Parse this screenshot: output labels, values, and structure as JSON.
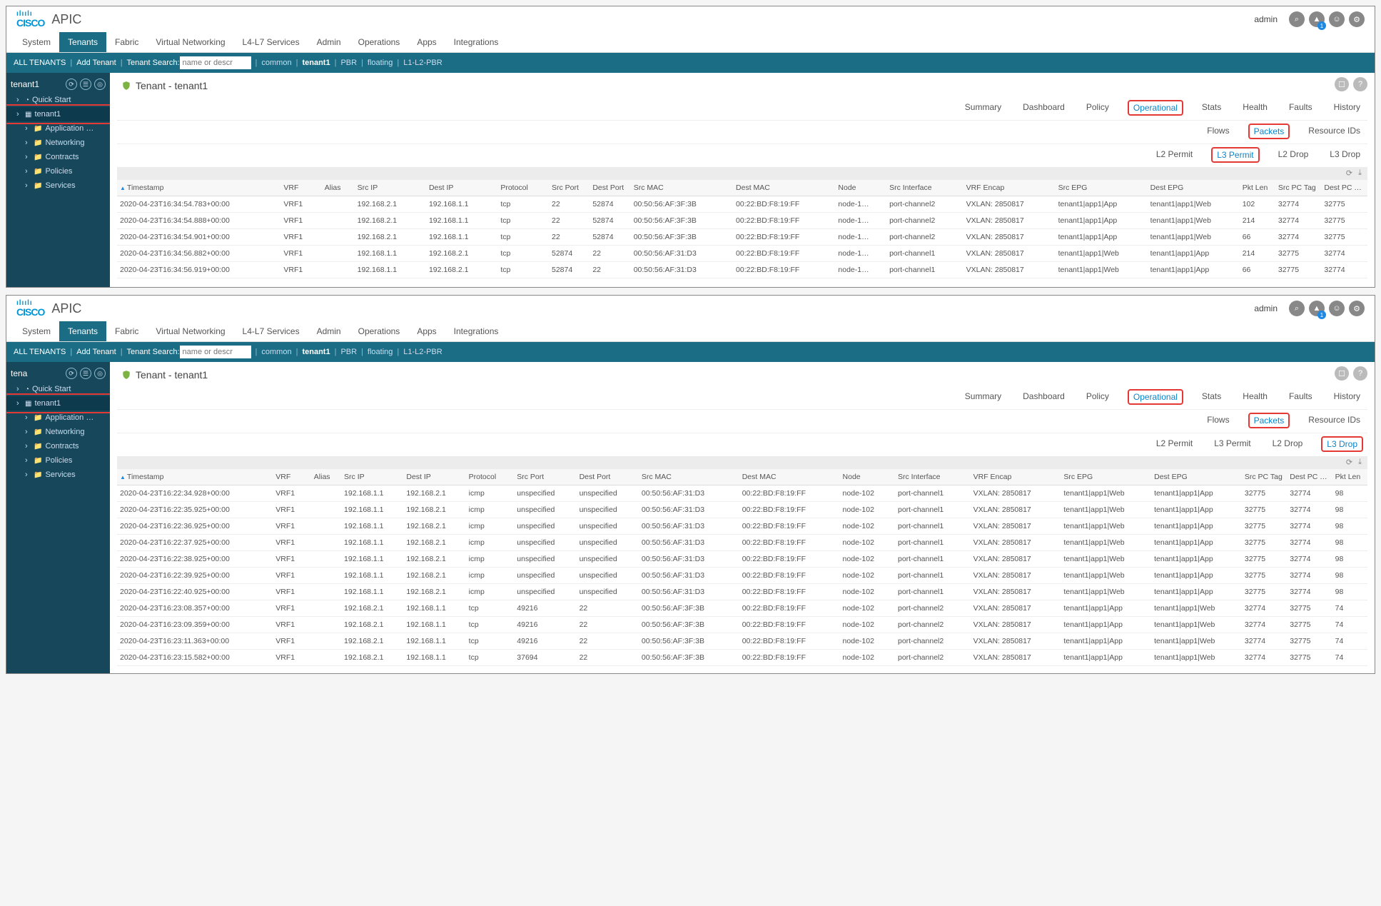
{
  "common": {
    "apic_title": "APIC",
    "user": "admin",
    "badge": "1",
    "menu": [
      "System",
      "Tenants",
      "Fabric",
      "Virtual Networking",
      "L4-L7 Services",
      "Admin",
      "Operations",
      "Apps",
      "Integrations"
    ],
    "menu_active": "Tenants",
    "subbar": {
      "all_tenants": "ALL TENANTS",
      "add_tenant": "Add Tenant",
      "tenant_search": "Tenant Search:",
      "placeholder": "name or descr",
      "links": [
        "common",
        "tenant1",
        "PBR",
        "floating",
        "L1-L2-PBR"
      ],
      "active_link": "tenant1"
    },
    "page_title_prefix": "Tenant - ",
    "tenant": "tenant1",
    "tabs1": [
      "Summary",
      "Dashboard",
      "Policy",
      "Operational",
      "Stats",
      "Health",
      "Faults",
      "History"
    ],
    "tabs1_active": "Operational",
    "tabs2": [
      "Flows",
      "Packets",
      "Resource IDs"
    ],
    "tabs2_active": "Packets",
    "tabs3": [
      "L2 Permit",
      "L3 Permit",
      "L2 Drop",
      "L3 Drop"
    ]
  },
  "top": {
    "sidebar_head": "tenant1",
    "tree": [
      {
        "label": "Quick Start",
        "icon": "◔",
        "sub": false
      },
      {
        "label": "tenant1",
        "icon": "▦",
        "sub": false,
        "selected": true,
        "highlight": true
      },
      {
        "label": "Application …",
        "icon": "📁",
        "sub": true,
        "obscured": true
      },
      {
        "label": "Networking",
        "icon": "📁",
        "sub": true
      },
      {
        "label": "Contracts",
        "icon": "📁",
        "sub": true
      },
      {
        "label": "Policies",
        "icon": "📁",
        "sub": true
      },
      {
        "label": "Services",
        "icon": "📁",
        "sub": true
      }
    ],
    "tabs3_active": "L3 Permit",
    "columns": [
      "Timestamp",
      "VRF",
      "Alias",
      "Src IP",
      "Dest IP",
      "Protocol",
      "Src Port",
      "Dest Port",
      "Src MAC",
      "Dest MAC",
      "Node",
      "Src Interface",
      "VRF Encap",
      "Src EPG",
      "Dest EPG",
      "Pkt Len",
      "Src PC Tag",
      "Dest PC Tag"
    ],
    "rows": [
      [
        "2020-04-23T16:34:54.783+00:00",
        "VRF1",
        "",
        "192.168.2.1",
        "192.168.1.1",
        "tcp",
        "22",
        "52874",
        "00:50:56:AF:3F:3B",
        "00:22:BD:F8:19:FF",
        "node-1…",
        "port-channel2",
        "VXLAN: 2850817",
        "tenant1|app1|App",
        "tenant1|app1|Web",
        "102",
        "32774",
        "32775"
      ],
      [
        "2020-04-23T16:34:54.888+00:00",
        "VRF1",
        "",
        "192.168.2.1",
        "192.168.1.1",
        "tcp",
        "22",
        "52874",
        "00:50:56:AF:3F:3B",
        "00:22:BD:F8:19:FF",
        "node-1…",
        "port-channel2",
        "VXLAN: 2850817",
        "tenant1|app1|App",
        "tenant1|app1|Web",
        "214",
        "32774",
        "32775"
      ],
      [
        "2020-04-23T16:34:54.901+00:00",
        "VRF1",
        "",
        "192.168.2.1",
        "192.168.1.1",
        "tcp",
        "22",
        "52874",
        "00:50:56:AF:3F:3B",
        "00:22:BD:F8:19:FF",
        "node-1…",
        "port-channel2",
        "VXLAN: 2850817",
        "tenant1|app1|App",
        "tenant1|app1|Web",
        "66",
        "32774",
        "32775"
      ],
      [
        "2020-04-23T16:34:56.882+00:00",
        "VRF1",
        "",
        "192.168.1.1",
        "192.168.2.1",
        "tcp",
        "52874",
        "22",
        "00:50:56:AF:31:D3",
        "00:22:BD:F8:19:FF",
        "node-1…",
        "port-channel1",
        "VXLAN: 2850817",
        "tenant1|app1|Web",
        "tenant1|app1|App",
        "214",
        "32775",
        "32774"
      ],
      [
        "2020-04-23T16:34:56.919+00:00",
        "VRF1",
        "",
        "192.168.1.1",
        "192.168.2.1",
        "tcp",
        "52874",
        "22",
        "00:50:56:AF:31:D3",
        "00:22:BD:F8:19:FF",
        "node-1…",
        "port-channel1",
        "VXLAN: 2850817",
        "tenant1|app1|Web",
        "tenant1|app1|App",
        "66",
        "32775",
        "32774"
      ]
    ]
  },
  "bottom": {
    "sidebar_head": "tena",
    "tree": [
      {
        "label": "Quick Start",
        "icon": "◔",
        "sub": false
      },
      {
        "label": "tenant1",
        "icon": "▦",
        "sub": false,
        "selected": true,
        "highlight": true
      },
      {
        "label": "Application …",
        "icon": "📁",
        "sub": true
      },
      {
        "label": "Networking",
        "icon": "📁",
        "sub": true
      },
      {
        "label": "Contracts",
        "icon": "📁",
        "sub": true
      },
      {
        "label": "Policies",
        "icon": "📁",
        "sub": true
      },
      {
        "label": "Services",
        "icon": "📁",
        "sub": true
      }
    ],
    "tabs3_active": "L3 Drop",
    "columns": [
      "Timestamp",
      "VRF",
      "Alias",
      "Src IP",
      "Dest IP",
      "Protocol",
      "Src Port",
      "Dest Port",
      "Src MAC",
      "Dest MAC",
      "Node",
      "Src Interface",
      "VRF Encap",
      "Src EPG",
      "Dest EPG",
      "Src PC Tag",
      "Dest PC Tag",
      "Pkt Len"
    ],
    "rows": [
      [
        "2020-04-23T16:22:34.928+00:00",
        "VRF1",
        "",
        "192.168.1.1",
        "192.168.2.1",
        "icmp",
        "unspecified",
        "unspecified",
        "00:50:56:AF:31:D3",
        "00:22:BD:F8:19:FF",
        "node-102",
        "port-channel1",
        "VXLAN: 2850817",
        "tenant1|app1|Web",
        "tenant1|app1|App",
        "32775",
        "32774",
        "98"
      ],
      [
        "2020-04-23T16:22:35.925+00:00",
        "VRF1",
        "",
        "192.168.1.1",
        "192.168.2.1",
        "icmp",
        "unspecified",
        "unspecified",
        "00:50:56:AF:31:D3",
        "00:22:BD:F8:19:FF",
        "node-102",
        "port-channel1",
        "VXLAN: 2850817",
        "tenant1|app1|Web",
        "tenant1|app1|App",
        "32775",
        "32774",
        "98"
      ],
      [
        "2020-04-23T16:22:36.925+00:00",
        "VRF1",
        "",
        "192.168.1.1",
        "192.168.2.1",
        "icmp",
        "unspecified",
        "unspecified",
        "00:50:56:AF:31:D3",
        "00:22:BD:F8:19:FF",
        "node-102",
        "port-channel1",
        "VXLAN: 2850817",
        "tenant1|app1|Web",
        "tenant1|app1|App",
        "32775",
        "32774",
        "98"
      ],
      [
        "2020-04-23T16:22:37.925+00:00",
        "VRF1",
        "",
        "192.168.1.1",
        "192.168.2.1",
        "icmp",
        "unspecified",
        "unspecified",
        "00:50:56:AF:31:D3",
        "00:22:BD:F8:19:FF",
        "node-102",
        "port-channel1",
        "VXLAN: 2850817",
        "tenant1|app1|Web",
        "tenant1|app1|App",
        "32775",
        "32774",
        "98"
      ],
      [
        "2020-04-23T16:22:38.925+00:00",
        "VRF1",
        "",
        "192.168.1.1",
        "192.168.2.1",
        "icmp",
        "unspecified",
        "unspecified",
        "00:50:56:AF:31:D3",
        "00:22:BD:F8:19:FF",
        "node-102",
        "port-channel1",
        "VXLAN: 2850817",
        "tenant1|app1|Web",
        "tenant1|app1|App",
        "32775",
        "32774",
        "98"
      ],
      [
        "2020-04-23T16:22:39.925+00:00",
        "VRF1",
        "",
        "192.168.1.1",
        "192.168.2.1",
        "icmp",
        "unspecified",
        "unspecified",
        "00:50:56:AF:31:D3",
        "00:22:BD:F8:19:FF",
        "node-102",
        "port-channel1",
        "VXLAN: 2850817",
        "tenant1|app1|Web",
        "tenant1|app1|App",
        "32775",
        "32774",
        "98"
      ],
      [
        "2020-04-23T16:22:40.925+00:00",
        "VRF1",
        "",
        "192.168.1.1",
        "192.168.2.1",
        "icmp",
        "unspecified",
        "unspecified",
        "00:50:56:AF:31:D3",
        "00:22:BD:F8:19:FF",
        "node-102",
        "port-channel1",
        "VXLAN: 2850817",
        "tenant1|app1|Web",
        "tenant1|app1|App",
        "32775",
        "32774",
        "98"
      ],
      [
        "2020-04-23T16:23:08.357+00:00",
        "VRF1",
        "",
        "192.168.2.1",
        "192.168.1.1",
        "tcp",
        "49216",
        "22",
        "00:50:56:AF:3F:3B",
        "00:22:BD:F8:19:FF",
        "node-102",
        "port-channel2",
        "VXLAN: 2850817",
        "tenant1|app1|App",
        "tenant1|app1|Web",
        "32774",
        "32775",
        "74"
      ],
      [
        "2020-04-23T16:23:09.359+00:00",
        "VRF1",
        "",
        "192.168.2.1",
        "192.168.1.1",
        "tcp",
        "49216",
        "22",
        "00:50:56:AF:3F:3B",
        "00:22:BD:F8:19:FF",
        "node-102",
        "port-channel2",
        "VXLAN: 2850817",
        "tenant1|app1|App",
        "tenant1|app1|Web",
        "32774",
        "32775",
        "74"
      ],
      [
        "2020-04-23T16:23:11.363+00:00",
        "VRF1",
        "",
        "192.168.2.1",
        "192.168.1.1",
        "tcp",
        "49216",
        "22",
        "00:50:56:AF:3F:3B",
        "00:22:BD:F8:19:FF",
        "node-102",
        "port-channel2",
        "VXLAN: 2850817",
        "tenant1|app1|App",
        "tenant1|app1|Web",
        "32774",
        "32775",
        "74"
      ],
      [
        "2020-04-23T16:23:15.582+00:00",
        "VRF1",
        "",
        "192.168.2.1",
        "192.168.1.1",
        "tcp",
        "37694",
        "22",
        "00:50:56:AF:3F:3B",
        "00:22:BD:F8:19:FF",
        "node-102",
        "port-channel2",
        "VXLAN: 2850817",
        "tenant1|app1|App",
        "tenant1|app1|Web",
        "32774",
        "32775",
        "74"
      ]
    ]
  }
}
